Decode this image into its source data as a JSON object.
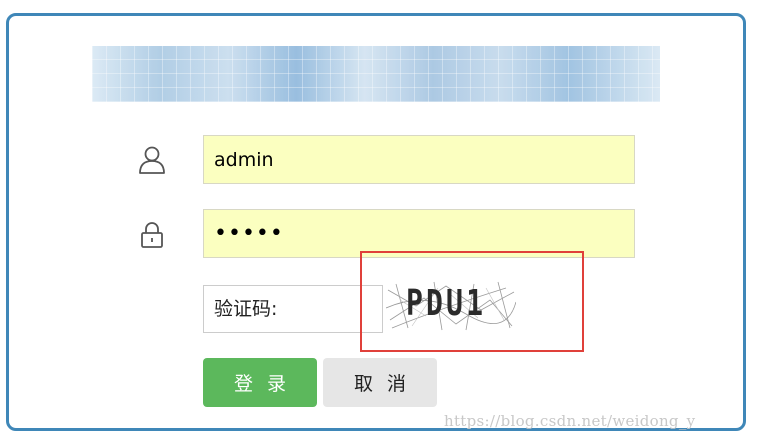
{
  "login_form": {
    "username_value": "admin",
    "password_value": "•••••",
    "captcha_label": "验证码:",
    "captcha_code": "PDU1",
    "login_label": "登录",
    "cancel_label": "取消"
  },
  "watermark": "https://blog.csdn.net/weidong_y",
  "colors": {
    "card_border": "#3f87b8",
    "input_bg": "#fbffc0",
    "login_button": "#5cb85c",
    "cancel_button": "#e6e6e6",
    "highlight_box": "#e0403a"
  },
  "icons": {
    "username": "user-icon",
    "password": "lock-icon"
  }
}
